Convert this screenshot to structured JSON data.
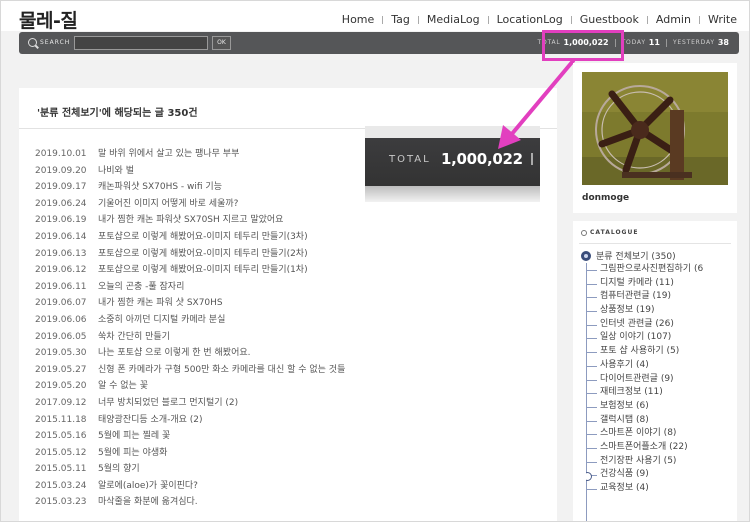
{
  "header": {
    "blog_title": "물레-질",
    "nav": [
      "Home",
      "Tag",
      "MediaLog",
      "LocationLog",
      "Guestbook",
      "Admin",
      "Write"
    ]
  },
  "searchbar": {
    "label": "SEARCH",
    "query": "",
    "ok_label": "OK",
    "total_label": "TOTAL",
    "total_value": "1,000,022",
    "today_label": "TODAY",
    "today_value": "11",
    "yesterday_label": "YESTERDAY",
    "yesterday_value": "38"
  },
  "main": {
    "title": "'분류 전체보기'에 해당되는 글 350건",
    "posts": [
      {
        "date": "2019.10.01",
        "title": "말 바위 위에서 살고 있는 팽나무 부부"
      },
      {
        "date": "2019.09.20",
        "title": "나비와 벌"
      },
      {
        "date": "2019.09.17",
        "title": "캐논파워샷 SX70HS - wifi 기능"
      },
      {
        "date": "2019.06.24",
        "title": "기울어진 이미지 어떻게 바로 세울까?"
      },
      {
        "date": "2019.06.19",
        "title": "내가 찜한 캐논 파워샷 SX70SH 지르고 말았어요"
      },
      {
        "date": "2019.06.14",
        "title": "포토샵으로 이렇게 해봤어요-이미지 테두리 만들기(3차)"
      },
      {
        "date": "2019.06.13",
        "title": "포토샵으로 이렇게 해봤어요-이미지 테두리 만들기(2차)"
      },
      {
        "date": "2019.06.12",
        "title": "포토샵으로 이렇게 해봤어요-이미지 테두리 만들기(1차)"
      },
      {
        "date": "2019.06.11",
        "title": "오늘의 곤충 -풀 잠자리"
      },
      {
        "date": "2019.06.07",
        "title": "내가 찜한 캐논 파워 샷 SX70HS"
      },
      {
        "date": "2019.06.06",
        "title": "소중히 아끼던 디지털 카메라 분실"
      },
      {
        "date": "2019.06.05",
        "title": "쑥차 간단히 만들기"
      },
      {
        "date": "2019.05.30",
        "title": "나는 포토샵 으로 이렇게 한 번 해봤어요."
      },
      {
        "date": "2019.05.27",
        "title": "신형 폰 카메라가 구형 500만 화소 카메라를 대신 할 수 없는 것들"
      },
      {
        "date": "2019.05.20",
        "title": "알 수 없는 꽃"
      },
      {
        "date": "2017.09.12",
        "title": "너무 방치되었던 블로그 먼지털기 (2)"
      },
      {
        "date": "2015.11.18",
        "title": "태양광잔디등 소개-개요 (2)"
      },
      {
        "date": "2015.05.16",
        "title": "5월에 피는 찔레 꽃"
      },
      {
        "date": "2015.05.12",
        "title": "5월에 피는 야생화"
      },
      {
        "date": "2015.05.11",
        "title": "5월의 향기"
      },
      {
        "date": "2015.03.24",
        "title": "알로에(aloe)가 꽃이핀다?"
      },
      {
        "date": "2015.03.23",
        "title": "마삭줄을 화분에 옮겨심다."
      }
    ]
  },
  "zoom": {
    "label": "TOTAL",
    "value": "1,000,022"
  },
  "sidebar": {
    "profile_name": "donmoge",
    "catalogue_label": "CATALOGUE",
    "root_category": "분류 전체보기 (350)",
    "categories": [
      "그림판으로사진편집하기 (6",
      "디지털 카메라 (11)",
      "컴퓨터관련글 (19)",
      "상품정보 (19)",
      "인터넷 관련글 (26)",
      "일상 이야기 (107)",
      "포토 샵 사용하기 (5)",
      "사용후기 (4)",
      "다이어트관련글 (9)",
      "재테크정보 (11)",
      "보험정보 (6)",
      "갤럭시탭 (8)",
      "스마트폰 이야기 (8)",
      "스마트폰어플소개 (22)",
      "전기장판 사용기 (5)",
      "건강식품 (9)",
      "교육정보 (4)"
    ]
  },
  "colors": {
    "highlight": "#e23fbf",
    "bar": "#555658",
    "tree": "#8d9bbf"
  }
}
